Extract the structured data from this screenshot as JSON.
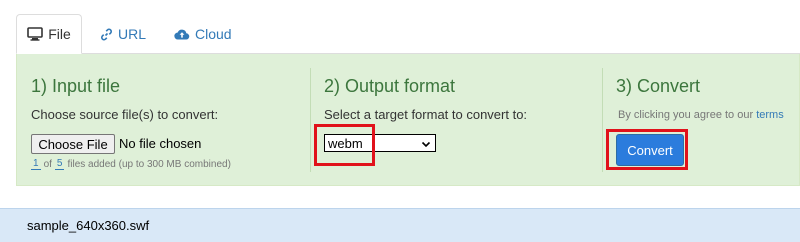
{
  "tabs": [
    {
      "label": "File",
      "icon": "monitor-icon",
      "active": true
    },
    {
      "label": "URL",
      "icon": "link-icon",
      "active": false
    },
    {
      "label": "Cloud",
      "icon": "cloud-upload-icon",
      "active": false
    }
  ],
  "input_section": {
    "title": "1) Input file",
    "instruction": "Choose source file(s) to convert:",
    "choose_button": "Choose File",
    "file_status": "No file chosen",
    "files_added": "1",
    "files_of": "of",
    "files_max": "5",
    "files_note": "files added (up to 300 MB combined)"
  },
  "output_section": {
    "title": "2) Output format",
    "instruction": "Select a target format to convert to:",
    "selected_format": "webm"
  },
  "convert_section": {
    "title": "3) Convert",
    "agreement_text": "By clicking you agree to our",
    "terms_link": "terms",
    "convert_button": "Convert"
  },
  "queue": {
    "file_name": "sample_640x360.swf"
  },
  "colors": {
    "panel_bg": "#dff0d8",
    "section_title": "#3c763d",
    "link": "#337ab7",
    "primary_button": "#2b7cdd",
    "highlight": "#e1121b",
    "queue_bg": "#d9e8f7"
  }
}
